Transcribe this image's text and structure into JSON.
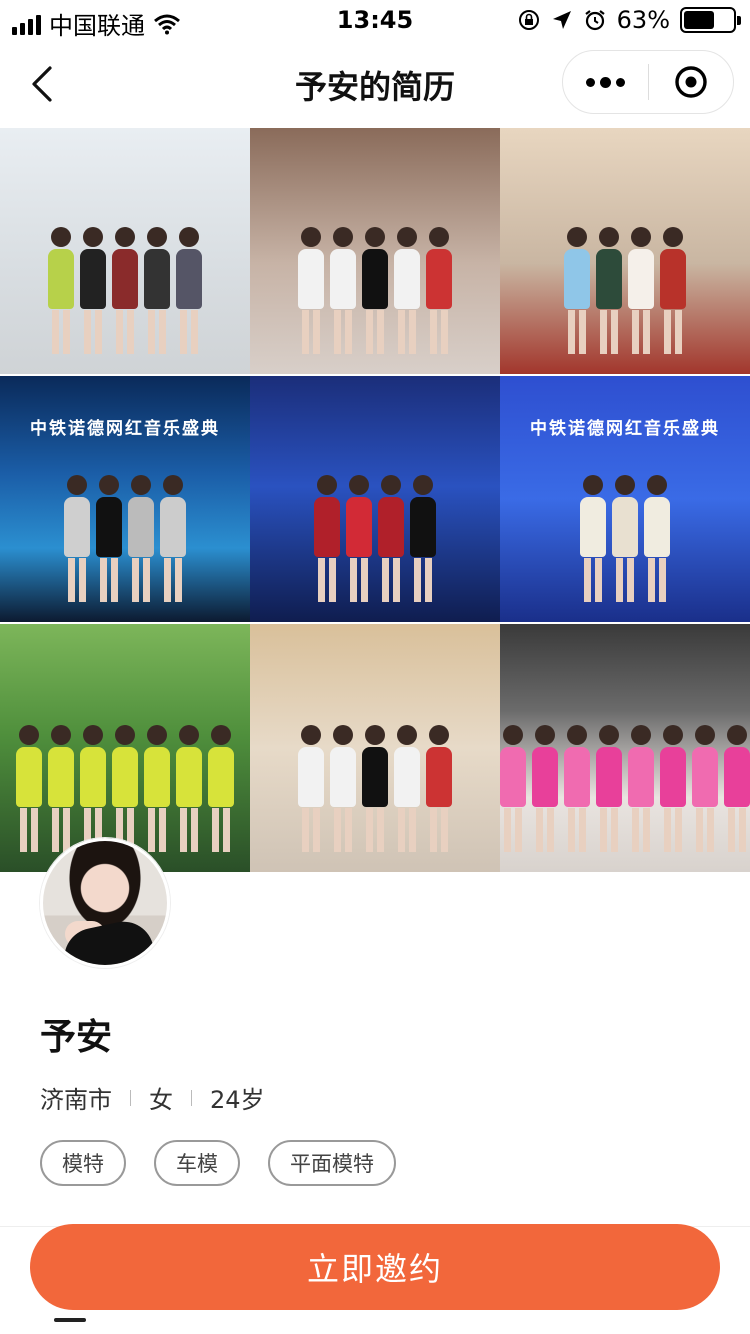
{
  "status_bar": {
    "carrier": "中国联通",
    "time": "13:45",
    "battery": "63%",
    "battery_level": 0.63
  },
  "nav": {
    "title": "予安的简历",
    "icons": [
      "back-arrow-icon",
      "more-icon",
      "close-target-icon"
    ]
  },
  "gallery": {
    "photos": [
      {
        "caption": "",
        "bg": "linear-gradient(180deg,#e9eef2 0%,#d9dee2 55%,#cfd3d6 100%)"
      },
      {
        "caption": "",
        "bg": "linear-gradient(180deg,#8a6b5a 0%,#c7b3a6 55%,#d8cfc9 100%)"
      },
      {
        "caption": "",
        "bg": "linear-gradient(180deg,#e8d6c0 0%,#c9b6a2 55%,#a2362c 100%)"
      },
      {
        "caption": "中铁诺德网红音乐盛典",
        "bg": "linear-gradient(180deg,#0a2a5a 0%,#1b5ea8 40%,#2b8fd0 70%,#0c1a30 100%)"
      },
      {
        "caption": "",
        "bg": "linear-gradient(180deg,#1b2e7a 0%,#2a52c0 45%,#0f1d4f 100%)"
      },
      {
        "caption": "中铁诺德网红音乐盛典",
        "bg": "linear-gradient(180deg,#2e4fd0 0%,#3a6be6 50%,#1a2f8a 100%)"
      },
      {
        "caption": "",
        "bg": "linear-gradient(180deg,#7db65a 0%,#4f8f3c 45%,#2a4f28 100%)"
      },
      {
        "caption": "",
        "bg": "linear-gradient(180deg,#d9c09a 0%,#e7dac8 50%,#cfc3b5 100%)"
      },
      {
        "caption": "",
        "bg": "linear-gradient(180deg,#3a3a3a 0%,#6b6b6b 35%,#e9e4e0 70%,#d8d2cd 100%)"
      }
    ]
  },
  "profile": {
    "name": "予安",
    "city": "济南市",
    "gender": "女",
    "age": "24岁",
    "tags": [
      "模特",
      "车模",
      "平面模特"
    ]
  },
  "cta": {
    "label": "立即邀约",
    "color": "#f2673b"
  }
}
